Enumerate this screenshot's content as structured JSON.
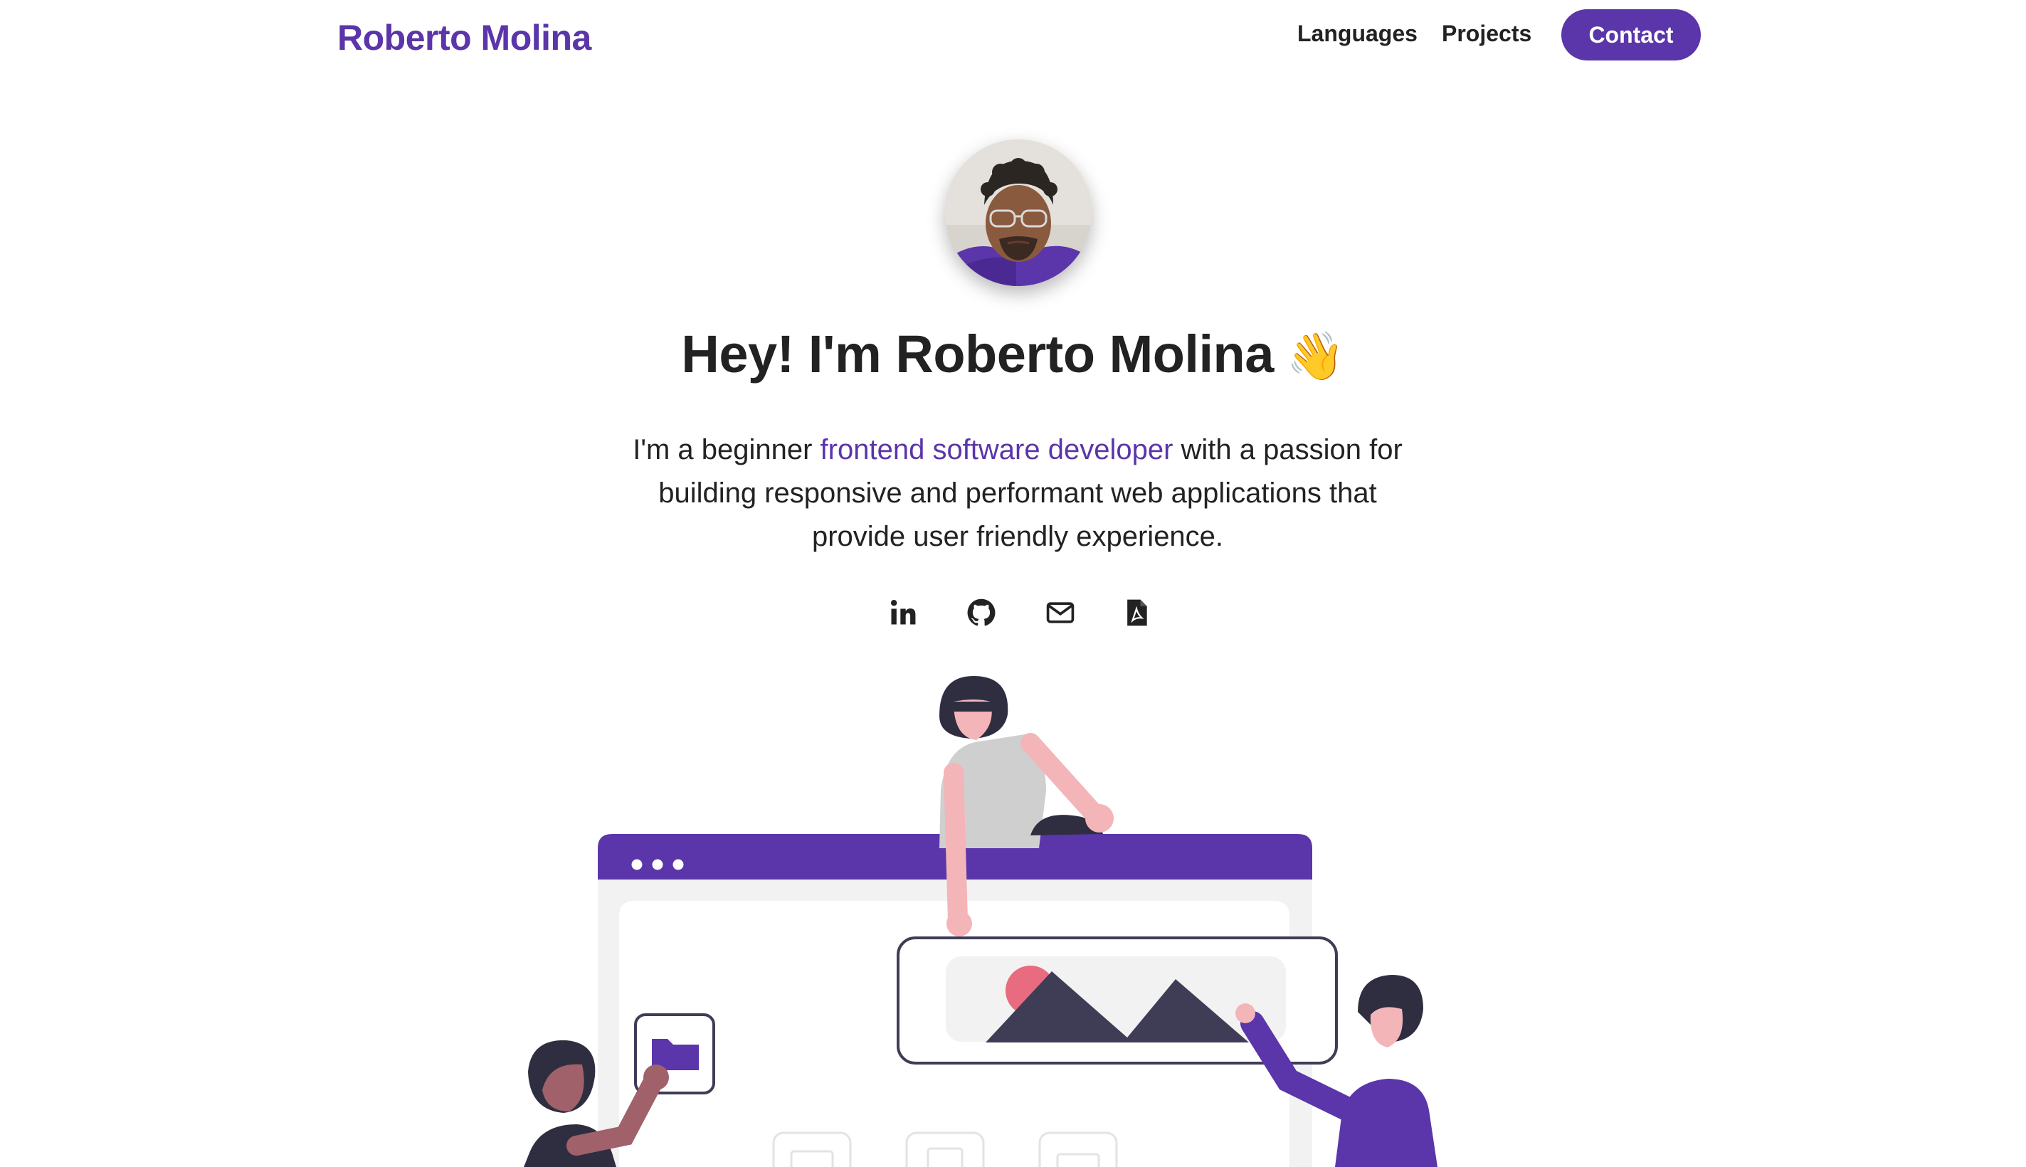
{
  "nav": {
    "brand": "Roberto Molina",
    "links": [
      {
        "label": "Languages"
      },
      {
        "label": "Projects"
      }
    ],
    "contact_label": "Contact"
  },
  "hero": {
    "title": "Hey! I'm Roberto Molina",
    "wave_emoji": "👋",
    "text_before": "I'm a beginner ",
    "text_highlight": "frontend software developer",
    "text_after": " with a passion for building responsive and performant web applications that provide user friendly experience.",
    "avatar_alt": "avatar-photo"
  },
  "social": [
    {
      "icon": "linkedin-icon"
    },
    {
      "icon": "github-icon"
    },
    {
      "icon": "mail-icon"
    },
    {
      "icon": "pdf-icon"
    }
  ],
  "colors": {
    "accent": "#5b35aa",
    "text": "#222222",
    "background": "#ffffff"
  }
}
